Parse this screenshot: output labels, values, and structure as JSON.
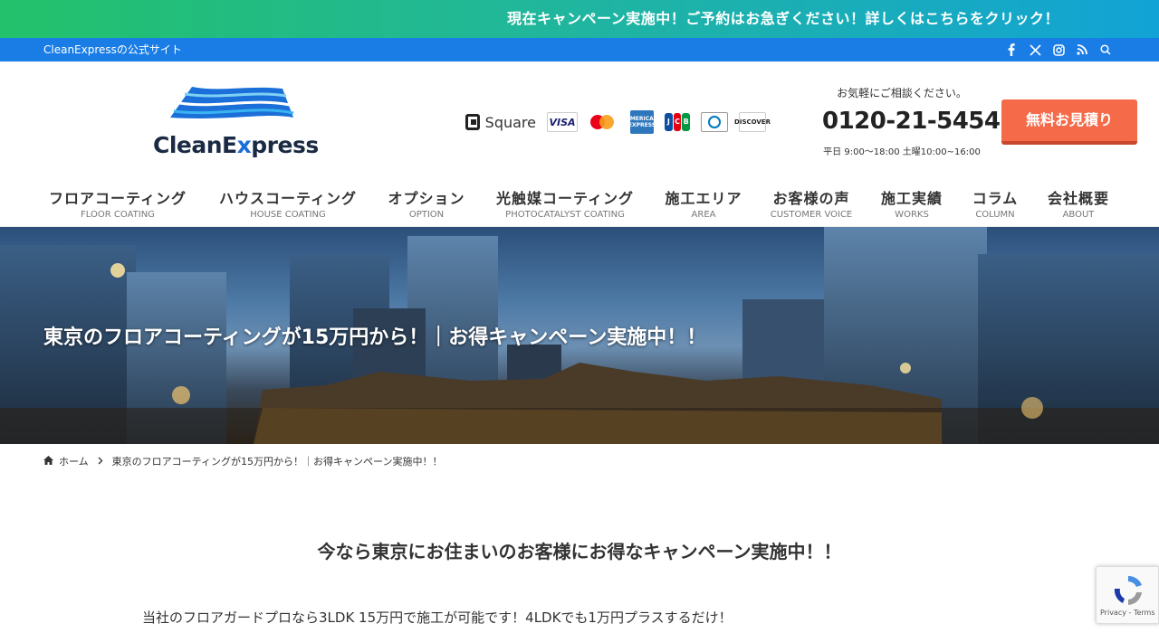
{
  "promo": {
    "text": "現在キャンペーン実施中！ご予約はお急ぎください！詳しくはこちらをクリック！"
  },
  "topbar": {
    "site_label": "CleanExpressの公式サイト",
    "icons": [
      "facebook-icon",
      "x-icon",
      "instagram-icon",
      "rss-icon",
      "search-icon"
    ]
  },
  "header": {
    "logo_text_1": "CleanE",
    "logo_text_x": "x",
    "logo_text_2": "press",
    "payments": {
      "square": "Square",
      "visa": "VISA",
      "amex": "AMERICAN EXPRESS",
      "discover": "DISCOVER"
    },
    "contact": {
      "lead": "お気軽にご相談ください。",
      "phone": "0120-21-5454",
      "hours": "平日 9:00〜18:00 土曜10:00~16:00"
    },
    "quote_button": "無料お見積り"
  },
  "nav": {
    "items": [
      {
        "jp": "フロアコーティング",
        "en": "FLOOR COATING"
      },
      {
        "jp": "ハウスコーティング",
        "en": "HOUSE COATING"
      },
      {
        "jp": "オプション",
        "en": "OPTION"
      },
      {
        "jp": "光触媒コーティング",
        "en": "PHOTOCATALYST COATING"
      },
      {
        "jp": "施工エリア",
        "en": "AREA"
      },
      {
        "jp": "お客様の声",
        "en": "CUSTOMER VOICE"
      },
      {
        "jp": "施工実績",
        "en": "WORKS"
      },
      {
        "jp": "コラム",
        "en": "COLUMN"
      },
      {
        "jp": "会社概要",
        "en": "ABOUT"
      }
    ]
  },
  "hero": {
    "title": "東京のフロアコーティングが15万円から！｜お得キャンペーン実施中！！"
  },
  "breadcrumb": {
    "home": "ホーム",
    "current": "東京のフロアコーティングが15万円から！｜お得キャンペーン実施中！！"
  },
  "main": {
    "heading": "今なら東京にお住まいのお客様にお得なキャンペーン実施中！！",
    "body": "当社のフロアガードプロなら3LDK 15万円で施工が可能です！4LDKでも1万円プラスするだけ！"
  },
  "recaptcha": {
    "terms": "Privacy - Terms"
  },
  "colors": {
    "accent": "#1a7de6",
    "cta": "#f56b4a",
    "promo_start": "#23c16b",
    "promo_end": "#12a3d6"
  }
}
